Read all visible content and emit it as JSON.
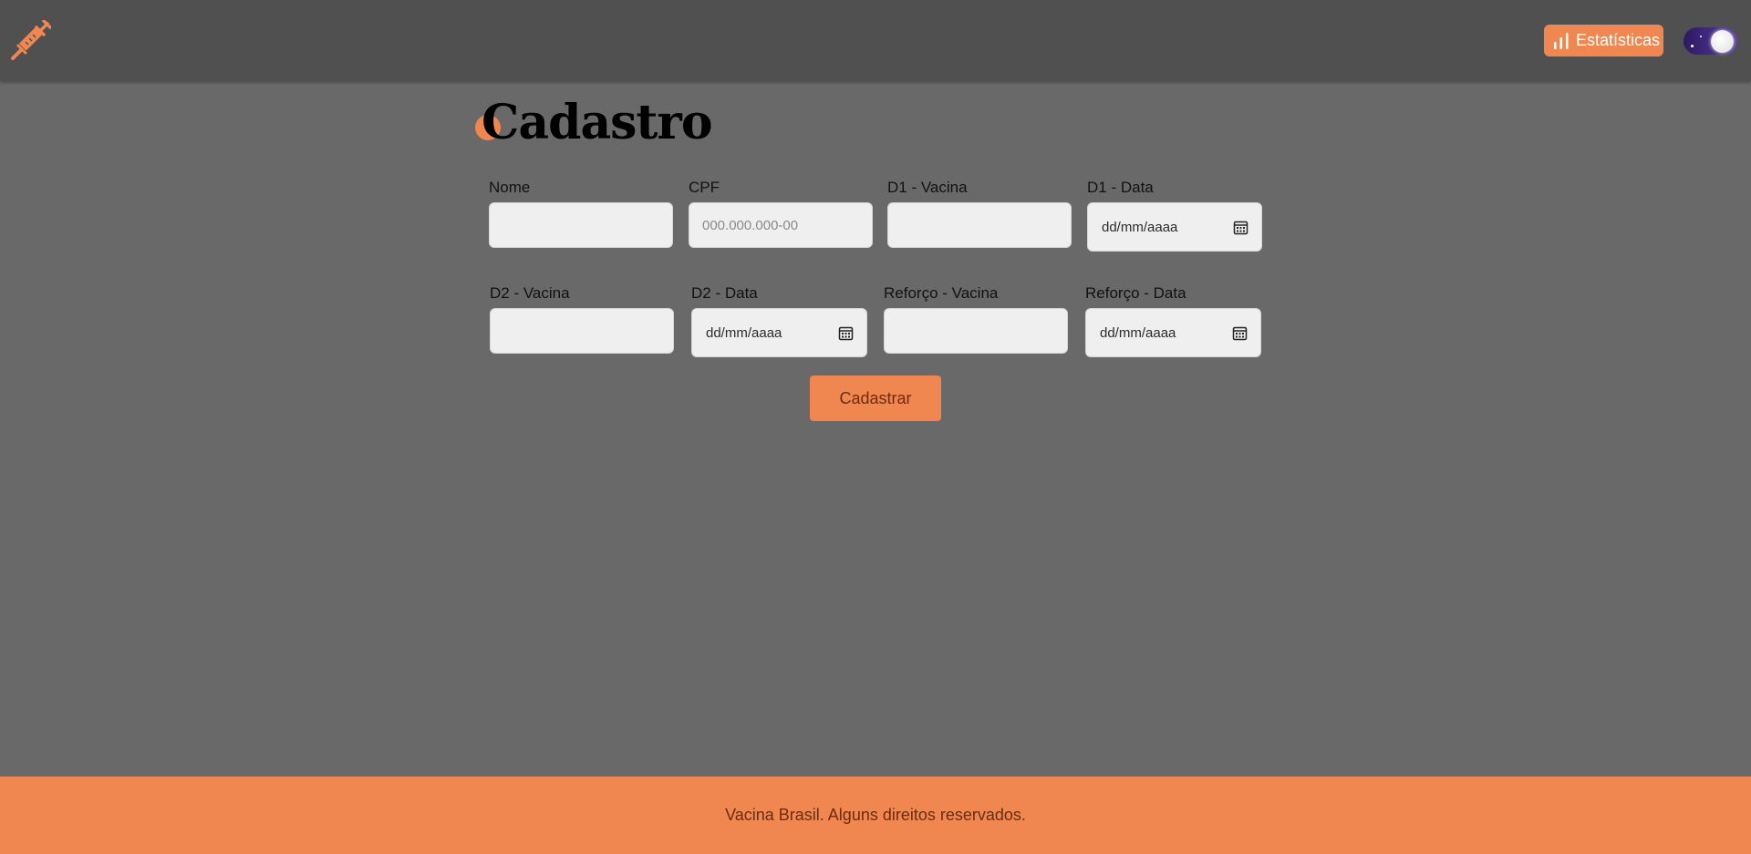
{
  "header": {
    "logo_icon": "syringe-icon",
    "stats_button": {
      "label": "Estatísticas",
      "icon": "bar-chart-icon"
    },
    "theme_toggle": {
      "icon": "moon-stars-toggle",
      "state": "dark"
    }
  },
  "form": {
    "title": "Cadastro",
    "fields": [
      {
        "label": "Nome",
        "value": "",
        "placeholder": ""
      },
      {
        "label": "CPF",
        "value": "",
        "placeholder": "000.000.000-00"
      },
      {
        "label": "D1 - Vacina",
        "value": "",
        "placeholder": ""
      },
      {
        "label": "D1 - Data",
        "value": "dd/mm/aaaa"
      },
      {
        "label": "D2 - Vacina",
        "value": "",
        "placeholder": ""
      },
      {
        "label": "D2 - Data",
        "value": "dd/mm/aaaa"
      },
      {
        "label": "Reforço - Vacina",
        "value": "",
        "placeholder": ""
      },
      {
        "label": "Reforço - Data",
        "value": "dd/mm/aaaa"
      }
    ],
    "submit_label": "Cadastrar"
  },
  "footer": {
    "text": "Vacina Brasil. Alguns direitos reservados."
  },
  "colors": {
    "accent": "#f08650",
    "background": "#696969",
    "topbar": "#505050",
    "input_bg": "#efefef"
  }
}
